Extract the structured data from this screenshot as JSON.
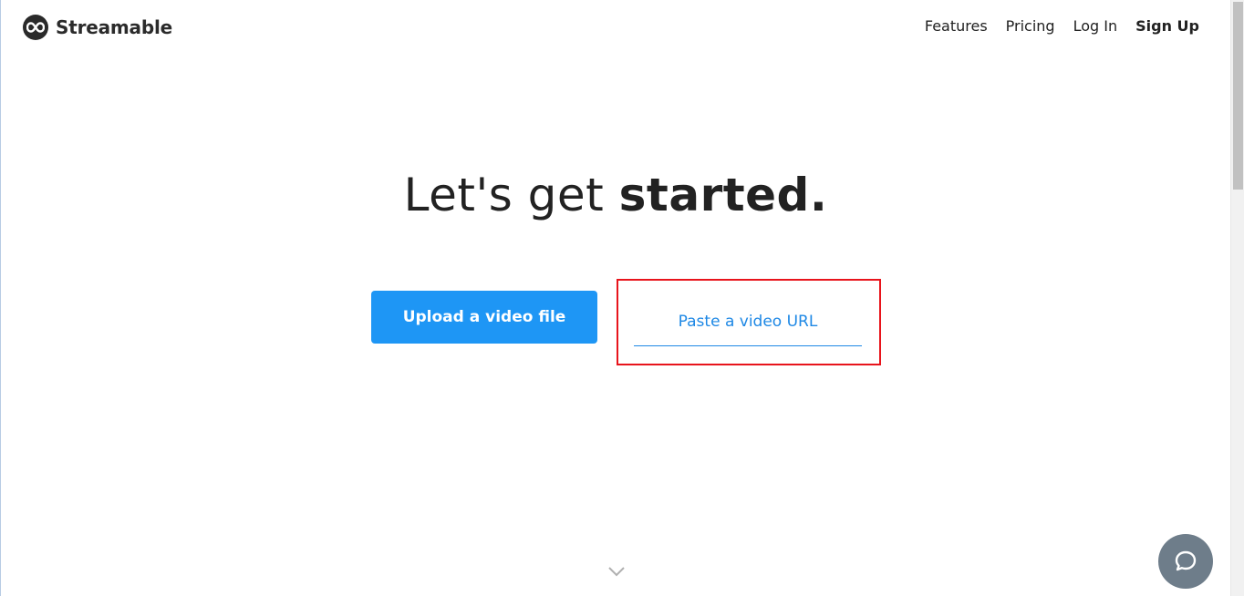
{
  "header": {
    "brand": "Streamable",
    "nav": [
      {
        "label": "Features"
      },
      {
        "label": "Pricing"
      },
      {
        "label": "Log In"
      },
      {
        "label": "Sign Up"
      }
    ]
  },
  "hero": {
    "headline_light": "Let's get ",
    "headline_bold": "started."
  },
  "actions": {
    "upload_label": "Upload a video file",
    "url_placeholder": "Paste a video URL",
    "url_value": ""
  },
  "colors": {
    "accent": "#1e96f5",
    "highlight": "#e8141c",
    "chat": "#6e7d8a"
  },
  "icons": {
    "logo": "infinity-logo-icon",
    "scroll": "chevron-down-icon",
    "chat": "chat-bubble-icon"
  }
}
